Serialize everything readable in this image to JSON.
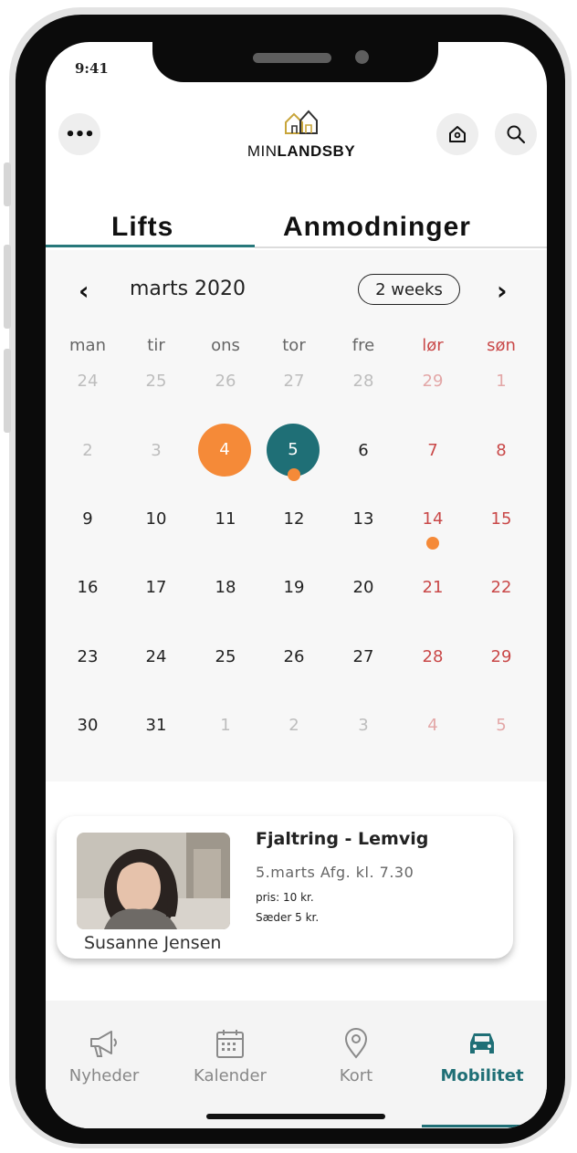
{
  "status_bar": {
    "time": "9:41"
  },
  "header": {
    "menu_label": "•••",
    "logo": {
      "prefix": "MIN",
      "suffix": "LANDSBY"
    }
  },
  "tabs": [
    {
      "label": "Lifts",
      "active": true
    },
    {
      "label": "Anmodninger",
      "active": false
    }
  ],
  "calendar": {
    "month_label": "marts 2020",
    "range_label": "2 weeks",
    "weekdays": [
      "man",
      "tir",
      "ons",
      "tor",
      "fre",
      "lør",
      "søn"
    ],
    "weeks": [
      [
        "24",
        "25",
        "26",
        "27",
        "28",
        "29",
        "1"
      ],
      [
        "2",
        "3",
        "4",
        "5",
        "6",
        "7",
        "8"
      ],
      [
        "9",
        "10",
        "11",
        "12",
        "13",
        "14",
        "15"
      ],
      [
        "16",
        "17",
        "18",
        "19",
        "20",
        "21",
        "22"
      ],
      [
        "23",
        "24",
        "25",
        "26",
        "27",
        "28",
        "29"
      ],
      [
        "30",
        "31",
        "1",
        "2",
        "3",
        "4",
        "5"
      ]
    ],
    "selected_today": "4",
    "selected_day": "5",
    "event_days": [
      "5",
      "14"
    ]
  },
  "ride_card": {
    "driver_name": "Susanne Jensen",
    "route": "Fjaltring  - Lemvig",
    "departure": "5.marts Afg. kl. 7.30",
    "price": "pris: 10 kr.",
    "seats": "Sæder 5 kr."
  },
  "bottom_nav": [
    {
      "label": "Nyheder",
      "icon": "megaphone-icon",
      "active": false
    },
    {
      "label": "Kalender",
      "icon": "calendar-icon",
      "active": false
    },
    {
      "label": "Kort",
      "icon": "map-pin-icon",
      "active": false
    },
    {
      "label": "Mobilitet",
      "icon": "car-icon",
      "active": true
    }
  ],
  "colors": {
    "accent": "#1f6f76",
    "highlight": "#f58a38",
    "weekend": "#c94848"
  }
}
